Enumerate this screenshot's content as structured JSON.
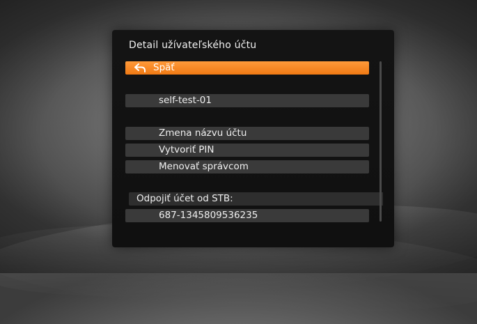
{
  "panel": {
    "title": "Detail užívateľského účtu",
    "back_label": "Späť",
    "account_name": "self-test-01",
    "menu_items": [
      {
        "label": "Zmena názvu účtu"
      },
      {
        "label": "Vytvoriť PIN"
      },
      {
        "label": "Menovať správcom"
      }
    ],
    "stb_section_label": "Odpojiť účet od STB:",
    "stb_id": "687-1345809536235"
  },
  "colors": {
    "accent": "#f5861f",
    "panel_bg": "#121212",
    "row_bg": "#3a3a3a"
  },
  "icons": {
    "back": "back-arrow-icon"
  }
}
